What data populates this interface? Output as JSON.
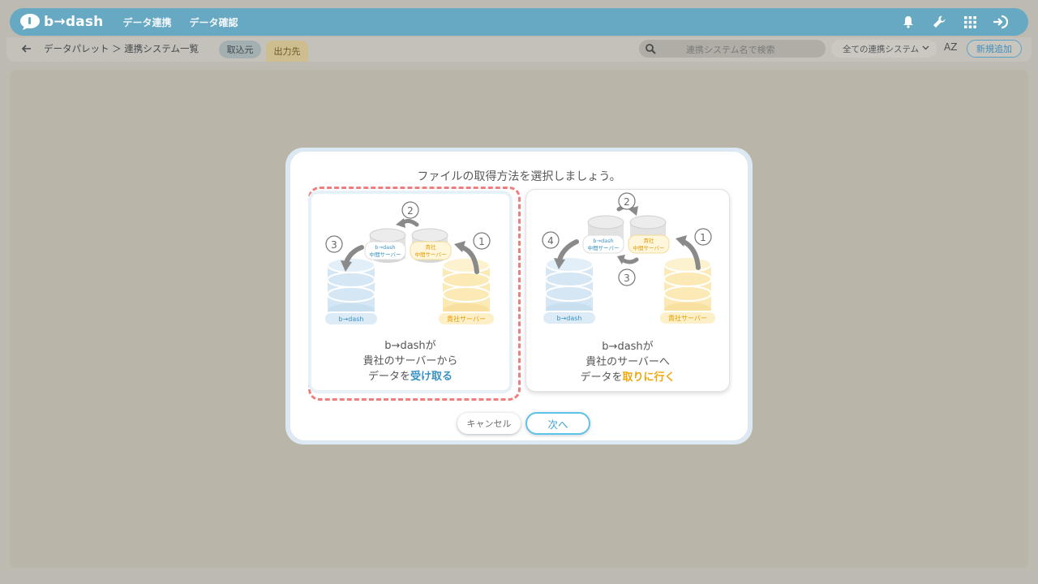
{
  "app": {
    "logo_text": "b→dash"
  },
  "nav": {
    "items": [
      "データ連携",
      "データ確認"
    ]
  },
  "header_icons": [
    "bell-icon",
    "wrench-icon",
    "grid-icon",
    "logout-icon"
  ],
  "subbar": {
    "breadcrumb": "データパレット ＞ 連携システム一覧",
    "tab_in": "取込元",
    "tab_out": "出力先",
    "search_placeholder": "連携システム名で検索",
    "filter_value": "全ての連携システム",
    "sort_label": "AZ",
    "new_button": "新規追加"
  },
  "modal": {
    "title": "ファイルの取得方法を選択しましょう。",
    "option_a": {
      "line1": "b→dashが",
      "line2": "貴社のサーバーから",
      "line3_prefix": "データを",
      "line3_highlight": "受け取る",
      "db_left": "b→dash",
      "db_right": "貴社サーバー",
      "mid_left_1": "b→dash",
      "mid_left_2": "中間サーバー",
      "mid_right_1": "貴社",
      "mid_right_2": "中間サーバー",
      "steps": [
        "1",
        "2",
        "3"
      ],
      "selected": true
    },
    "option_b": {
      "line1": "b→dashが",
      "line2": "貴社のサーバーへ",
      "line3_prefix": "データを",
      "line3_highlight": "取りに行く",
      "db_left": "b→dash",
      "db_right": "貴社サーバー",
      "mid_left_1": "b→dash",
      "mid_left_2": "中間サーバー",
      "mid_right_1": "貴社",
      "mid_right_2": "中間サーバー",
      "steps": [
        "1",
        "2",
        "3",
        "4"
      ],
      "selected": false
    },
    "cancel_label": "キャンセル",
    "next_label": "次へ"
  },
  "colors": {
    "header": "#67a9c3",
    "accent_blue": "#3a92c4",
    "accent_orange": "#f0a70f",
    "selection_border": "#ef7f7f"
  }
}
